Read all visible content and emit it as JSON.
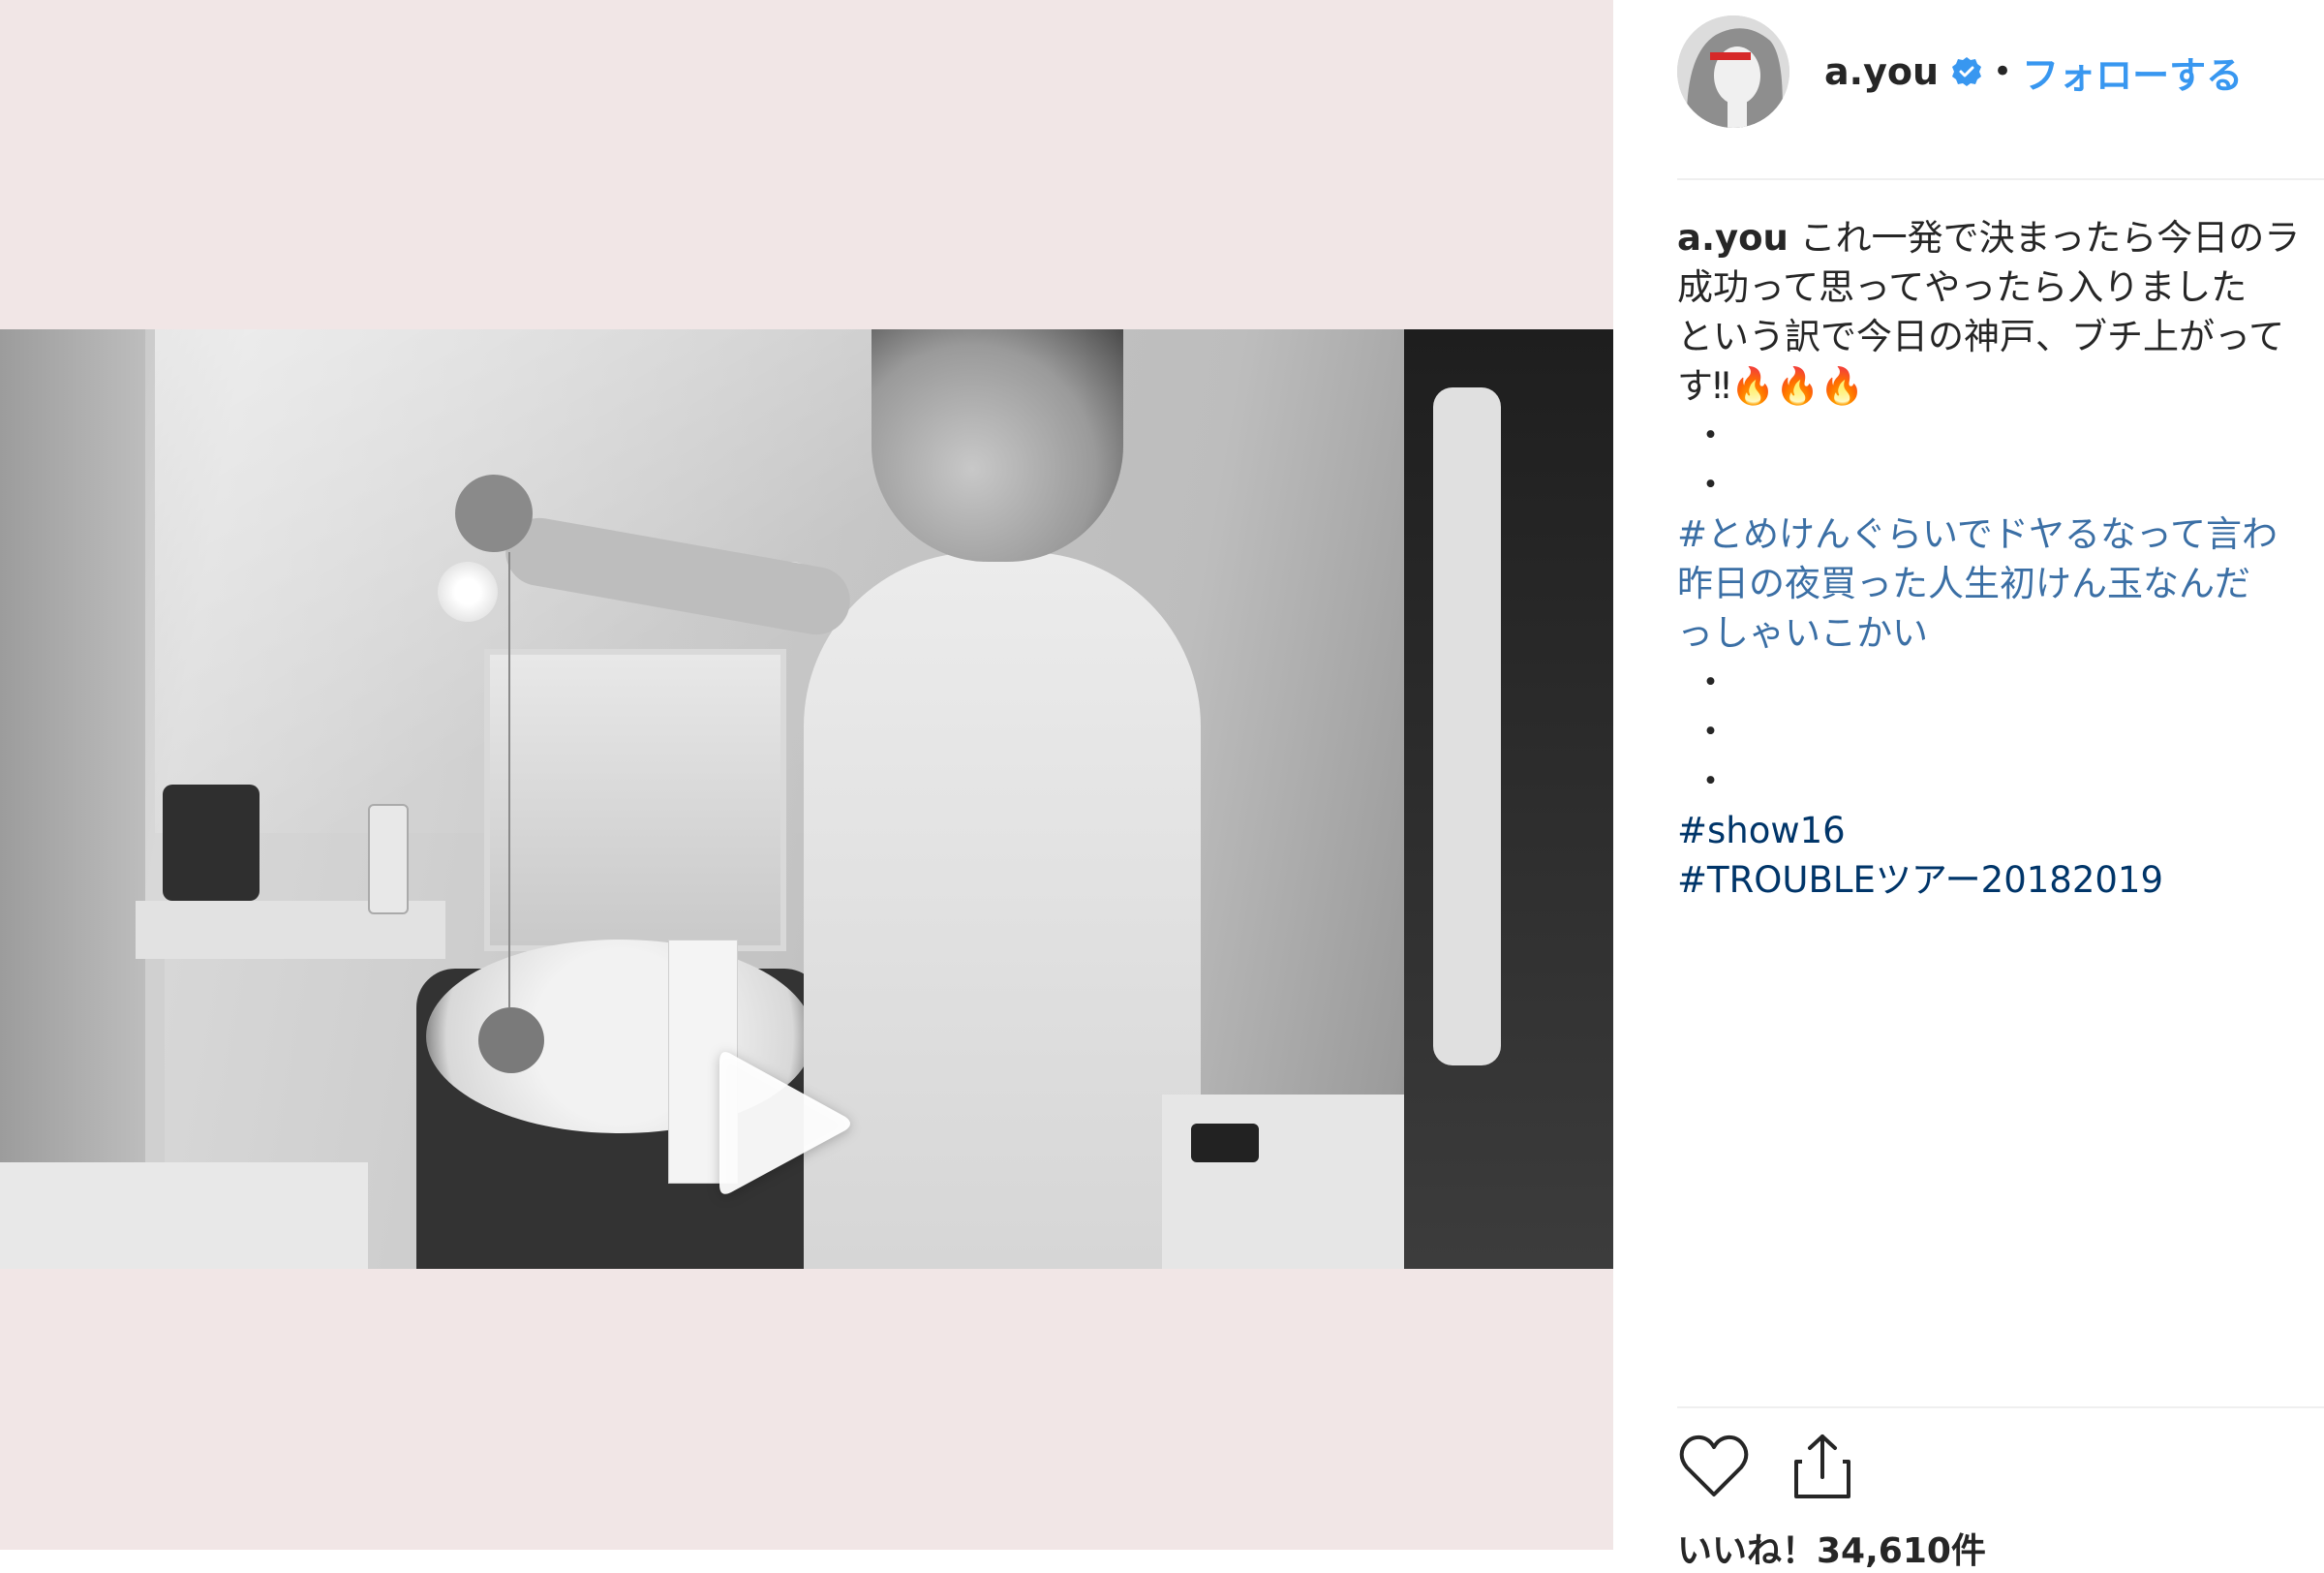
{
  "post": {
    "username": "a.you",
    "follow_separator": "•",
    "follow_label": "フォローする",
    "caption": {
      "user": "a.you",
      "lines": [
        "これ一発で決まったら今日のラ",
        "成功って思ってやったら入りました",
        "という訳で今日の神戸、ブチ上がって",
        "す‼🔥🔥🔥"
      ],
      "dots_a": [
        "・",
        "・"
      ],
      "hashtag_lines": [
        "#とめけんぐらいでドヤるなって言わ",
        "昨日の夜買った人生初けん玉なんだ",
        "っしゃいこかい"
      ],
      "dots_b": [
        "・",
        "・",
        "・"
      ],
      "hashtags": [
        "#show16",
        "#TROUBLEツアー20182019"
      ]
    },
    "likes_label": "いいね！34,610件"
  },
  "icons": {
    "verified": "verified-badge-icon",
    "play": "play-icon",
    "like": "heart-icon",
    "share": "share-icon"
  },
  "colors": {
    "media_background": "#f1e6e6",
    "link_blue": "#3897f0",
    "hashtag_blue": "#003569"
  }
}
